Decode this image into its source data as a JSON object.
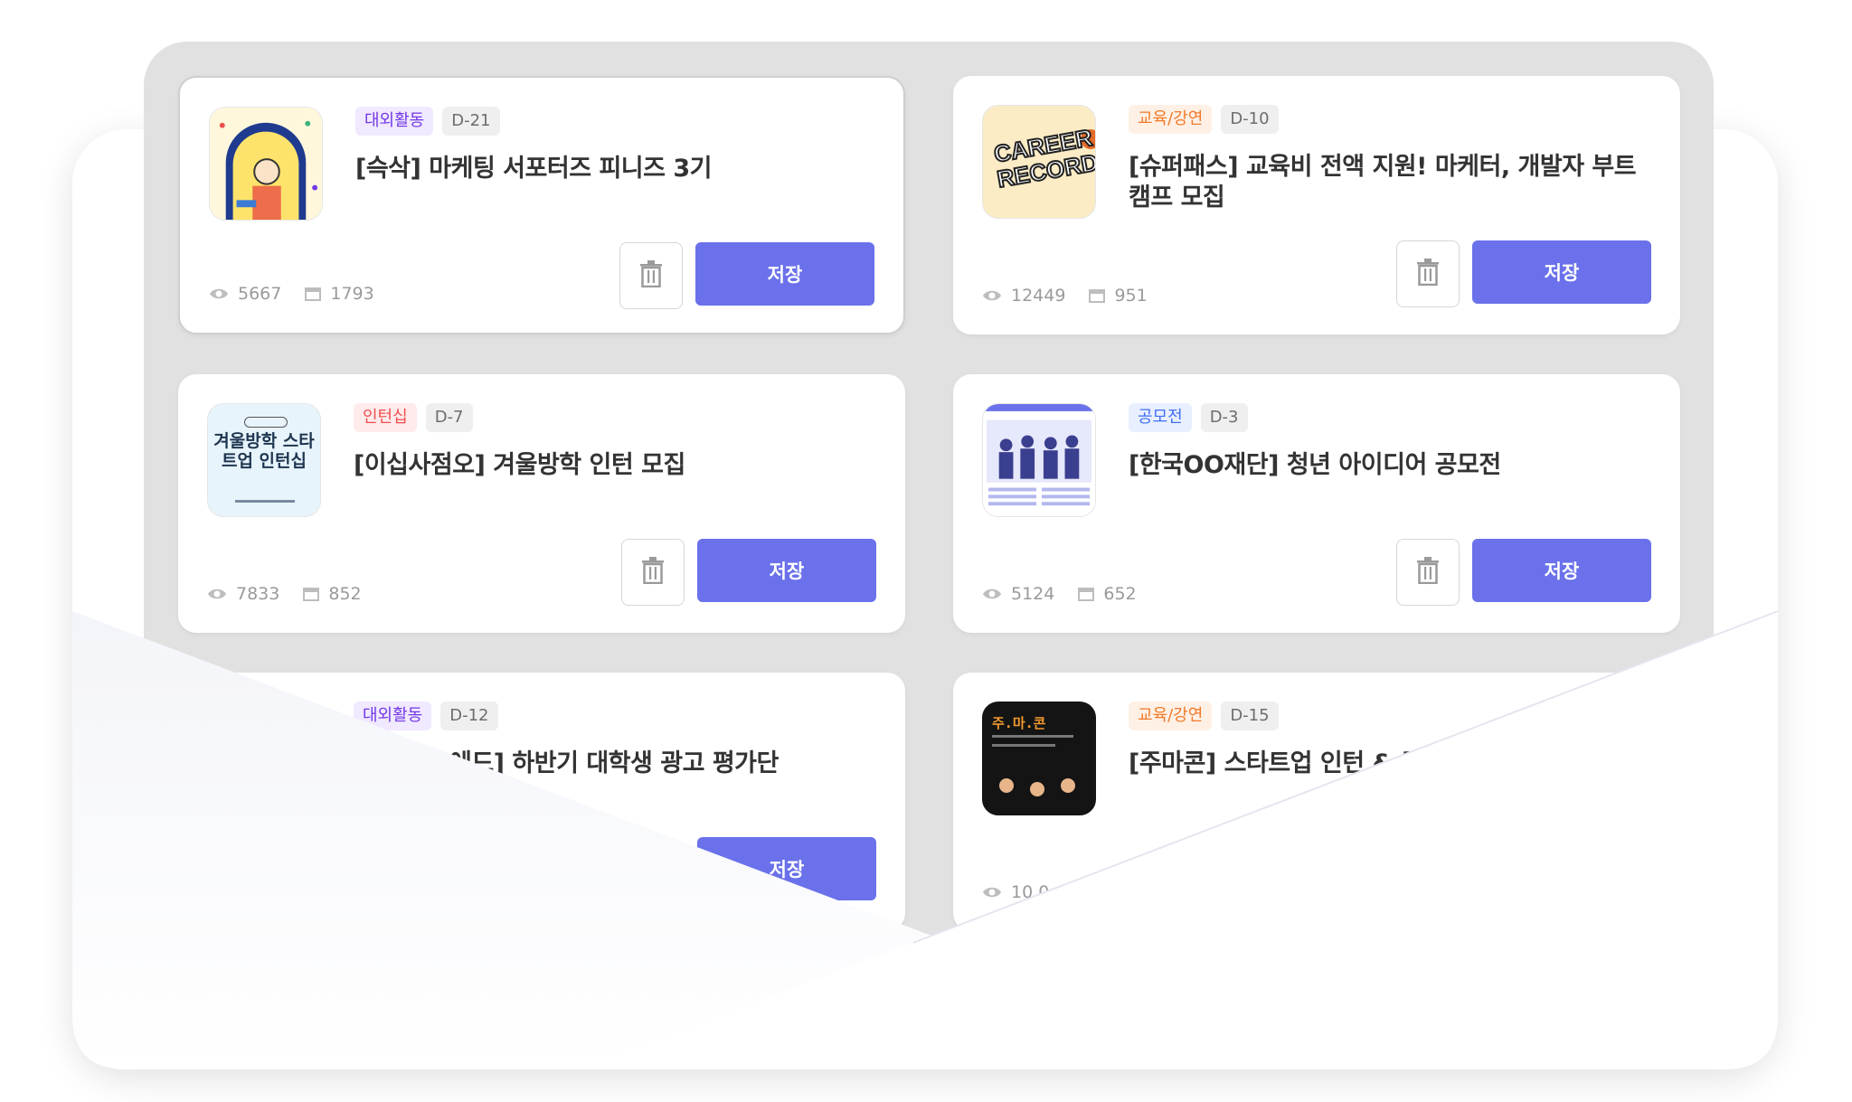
{
  "cards": [
    {
      "category": "대외활동",
      "dday": "D-21",
      "title": "[슥삭] 마케팅 서포터즈 피니즈 3기",
      "views": "5667",
      "saves": "1793",
      "save_label": "저장"
    },
    {
      "category": "교육/강연",
      "dday": "D-10",
      "title": "[슈퍼패스] 교육비 전액 지원! 마케터, 개발자 부트캠프 모집",
      "views": "12449",
      "saves": "951",
      "save_label": "저장",
      "thumb_text": "CAREER RECORD"
    },
    {
      "category": "인턴십",
      "dday": "D-7",
      "title": "[이십사점오] 겨울방학 인턴 모집",
      "views": "7833",
      "saves": "852",
      "save_label": "저장",
      "thumb_text": "겨울방학 스타트업 인턴십"
    },
    {
      "category": "공모전",
      "dday": "D-3",
      "title": "[한국OO재단] 청년 아이디어 공모전",
      "views": "5124",
      "saves": "652",
      "save_label": "저장"
    },
    {
      "category": "대외활동",
      "dday": "D-12",
      "title": "에드] 하반기 대학생 광고 평가단",
      "save_label": "저장"
    },
    {
      "category": "교육/강연",
      "dday": "D-15",
      "title": "[주마콘] 스타트업 인턴 & 주",
      "views": "10,0",
      "thumb_text": "주.마.콘"
    }
  ],
  "colors": {
    "accent": "#6a71ea",
    "tray": "#e1e1e1"
  }
}
